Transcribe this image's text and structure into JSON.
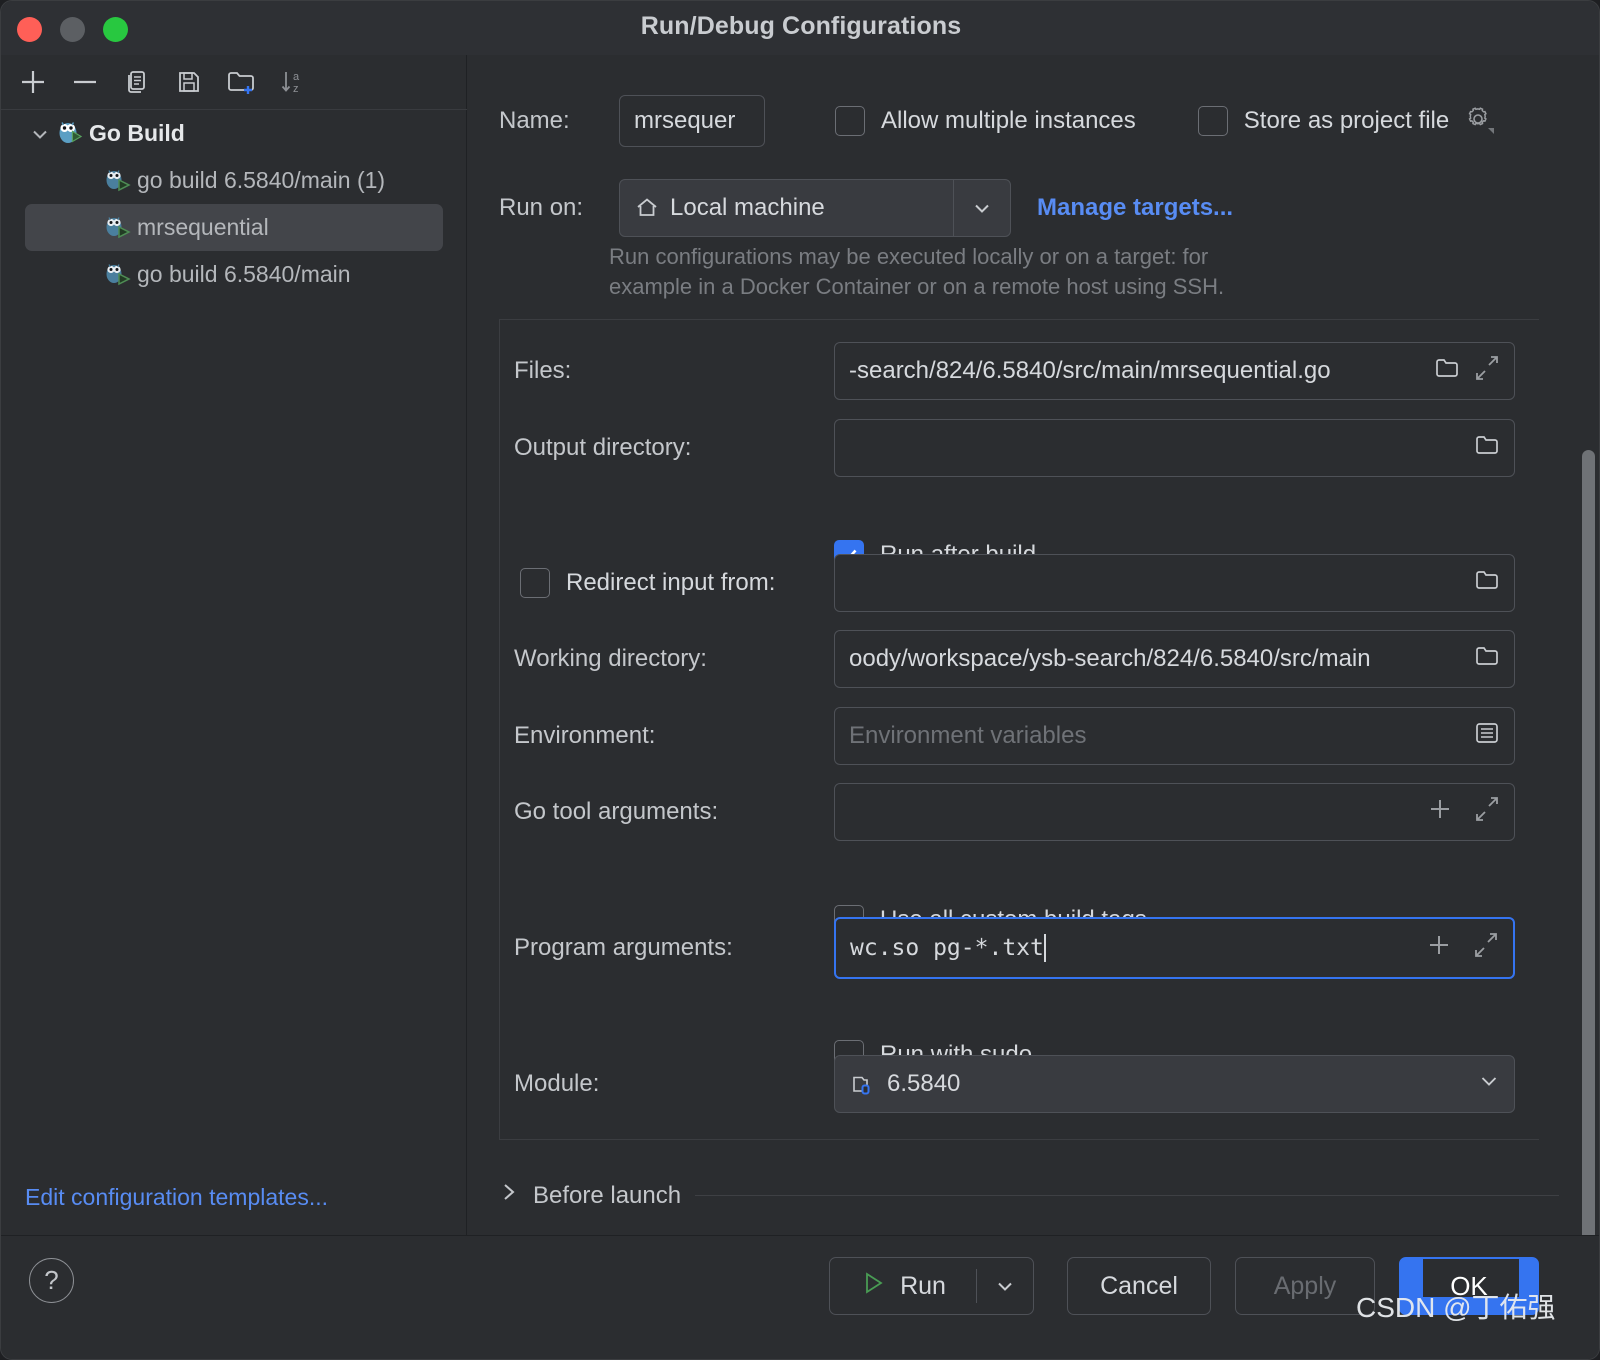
{
  "window": {
    "title": "Run/Debug Configurations",
    "traffic_lights": [
      "close-button",
      "minimize-button",
      "zoom-button"
    ]
  },
  "sidebar": {
    "toolbar": [
      {
        "name": "add-configuration-button",
        "icon": "plus-icon"
      },
      {
        "name": "remove-configuration-button",
        "icon": "minus-icon"
      },
      {
        "name": "copy-configuration-button",
        "icon": "copy-icon"
      },
      {
        "name": "save-configuration-button",
        "icon": "save-icon"
      },
      {
        "name": "new-folder-button",
        "icon": "new-folder-icon"
      },
      {
        "name": "sort-configurations-button",
        "icon": "sort-az-icon"
      }
    ],
    "tree": {
      "group_label": "Go Build",
      "items": [
        {
          "label": "go build 6.5840/main (1)",
          "selected": false
        },
        {
          "label": "mrsequential",
          "selected": true
        },
        {
          "label": "go build 6.5840/main",
          "selected": false
        }
      ]
    },
    "edit_templates_link": "Edit configuration templates..."
  },
  "form": {
    "name_label": "Name:",
    "name_value": "mrsequer",
    "allow_multiple_instances_label": "Allow multiple instances",
    "allow_multiple_instances_checked": false,
    "store_as_project_file_label": "Store as project file",
    "store_as_project_file_checked": false,
    "run_on_label": "Run on:",
    "run_on_value": "Local machine",
    "manage_targets_link": "Manage targets...",
    "hint_line1": "Run configurations may be executed locally or on a target: for",
    "hint_line2": "example in a Docker Container or on a remote host using SSH.",
    "files_label": "Files:",
    "files_value": "-search/824/6.5840/src/main/mrsequential.go",
    "output_directory_label": "Output directory:",
    "output_directory_value": "",
    "run_after_build_label": "Run after build",
    "run_after_build_checked": true,
    "redirect_input_label": "Redirect input from:",
    "redirect_input_checked": false,
    "redirect_input_value": "",
    "working_directory_label": "Working directory:",
    "working_directory_value": "oody/workspace/ysb-search/824/6.5840/src/main",
    "environment_label": "Environment:",
    "environment_placeholder": "Environment variables",
    "environment_value": "",
    "go_tool_arguments_label": "Go tool arguments:",
    "go_tool_arguments_value": "",
    "use_all_custom_build_tags_label": "Use all custom build tags",
    "use_all_custom_build_tags_checked": false,
    "program_arguments_label": "Program arguments:",
    "program_arguments_value": "wc.so pg-*.txt",
    "run_with_sudo_label": "Run with sudo",
    "run_with_sudo_checked": false,
    "module_label": "Module:",
    "module_value": "6.5840",
    "before_launch_label": "Before launch"
  },
  "footer": {
    "help_label": "?",
    "run_label": "Run",
    "cancel_label": "Cancel",
    "apply_label": "Apply",
    "apply_disabled": true,
    "ok_label": "OK"
  },
  "watermark": "CSDN @丁佑强",
  "colors": {
    "accent": "#3574f0",
    "link": "#588cf3",
    "background": "#2b2d30",
    "field_border": "#4e5157",
    "text": "#d6d9dd",
    "muted_text": "#7a7d82",
    "run_green": "#499c54"
  }
}
